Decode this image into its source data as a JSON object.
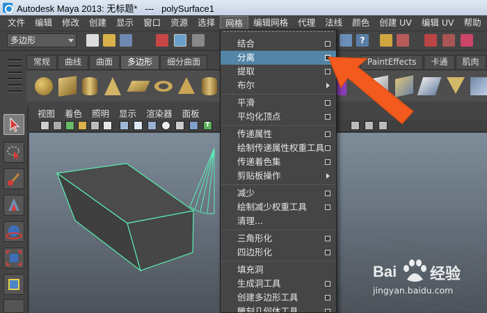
{
  "window": {
    "title": "Autodesk Maya 2013: 无标题*   ---   polySurface1"
  },
  "menubar": {
    "items": [
      "文件",
      "编辑",
      "修改",
      "创建",
      "显示",
      "窗口",
      "资源",
      "选择",
      "网格",
      "编辑网格",
      "代理",
      "法线",
      "颜色",
      "创建 UV",
      "编辑 UV",
      "帮助"
    ],
    "active": "网格"
  },
  "statusline": {
    "mode": "多边形"
  },
  "shelf": {
    "tabs": [
      "常规",
      "曲线",
      "曲面",
      "多边形",
      "细分曲面"
    ],
    "active_tab": "多边形",
    "right_tabs": [
      "PaintEffects",
      "卡通",
      "肌肉"
    ]
  },
  "panel_menu": {
    "items": [
      "视图",
      "着色",
      "照明",
      "显示",
      "渲染器",
      "面板"
    ]
  },
  "mesh_menu": {
    "selected": "分离",
    "items": [
      {
        "label": "结合",
        "opt": true
      },
      {
        "label": "分离",
        "opt": true
      },
      {
        "label": "提取",
        "opt": true
      },
      {
        "label": "布尔",
        "sub": true
      },
      {
        "sep": true
      },
      {
        "label": "平滑",
        "opt": true
      },
      {
        "label": "平均化顶点",
        "opt": true
      },
      {
        "sep": true
      },
      {
        "label": "传递属性",
        "opt": true
      },
      {
        "label": "绘制传递属性权重工具",
        "opt": true
      },
      {
        "label": "传递着色集",
        "opt": true
      },
      {
        "label": "剪贴板操作",
        "sub": true
      },
      {
        "sep": true
      },
      {
        "label": "减少",
        "opt": true
      },
      {
        "label": "绘制减少权重工具",
        "opt": true
      },
      {
        "label": "清理...",
        "opt": false
      },
      {
        "sep": true
      },
      {
        "label": "三角形化",
        "opt": true
      },
      {
        "label": "四边形化",
        "opt": true
      },
      {
        "sep": true
      },
      {
        "label": "填充洞",
        "opt": false
      },
      {
        "label": "生成洞工具",
        "opt": true
      },
      {
        "label": "创建多边形工具",
        "opt": true
      },
      {
        "label": "雕刻几何体工具",
        "opt": true
      }
    ]
  },
  "watermark": {
    "brand": "Bai",
    "brand2": "经验",
    "url": "jingyan.baidu.com"
  },
  "colors": {
    "highlight": "#5285a6",
    "selection_wire": "#59f0b4",
    "arrow": "#f25a1e"
  }
}
